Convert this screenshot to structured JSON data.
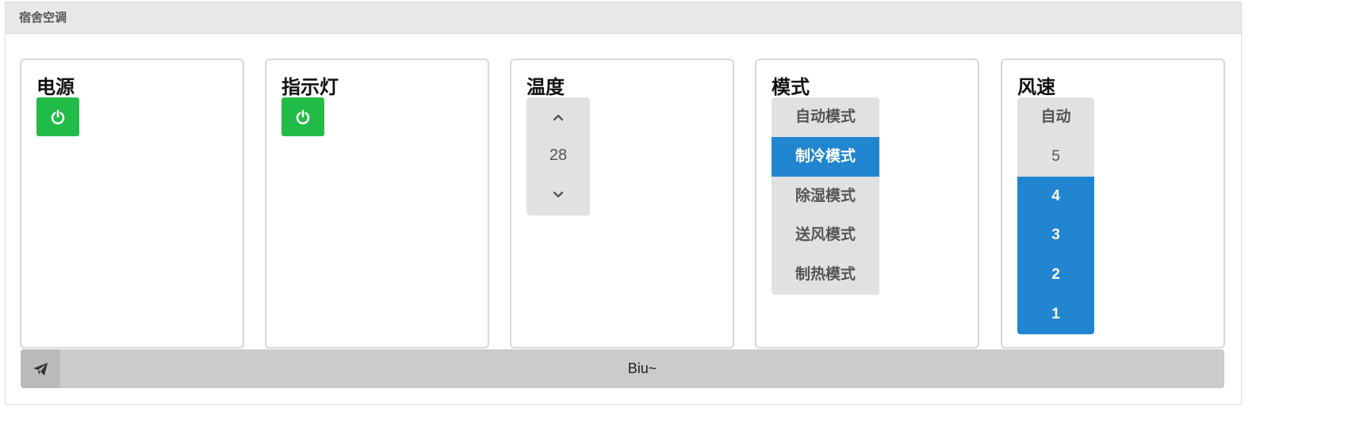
{
  "panel": {
    "title": "宿舍空调"
  },
  "power": {
    "title": "电源",
    "icon": "power-icon",
    "color": "#21bb47"
  },
  "indicator": {
    "title": "指示灯",
    "icon": "power-icon",
    "color": "#21bb47"
  },
  "temperature": {
    "title": "温度",
    "value": "28",
    "up_icon": "chevron-up-icon",
    "down_icon": "chevron-down-icon"
  },
  "mode": {
    "title": "模式",
    "items": [
      {
        "label": "自动模式",
        "active": false
      },
      {
        "label": "制冷模式",
        "active": true
      },
      {
        "label": "除湿模式",
        "active": false
      },
      {
        "label": "送风模式",
        "active": false
      },
      {
        "label": "制热模式",
        "active": false
      }
    ]
  },
  "speed": {
    "title": "风速",
    "items": [
      {
        "label": "自动",
        "active": false
      },
      {
        "label": "5",
        "active": false
      },
      {
        "label": "4",
        "active": true
      },
      {
        "label": "3",
        "active": true
      },
      {
        "label": "2",
        "active": true
      },
      {
        "label": "1",
        "active": true
      }
    ]
  },
  "submit": {
    "label": "Biu~",
    "icon": "paper-plane-icon"
  },
  "colors": {
    "accent": "#2185d0",
    "power_on": "#21bb47",
    "button_grey": "#e0e1e2"
  }
}
